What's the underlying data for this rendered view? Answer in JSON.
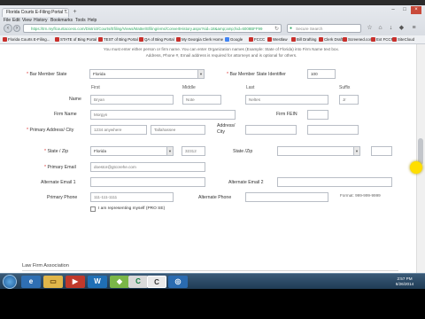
{
  "browser": {
    "tab1": "Florida Courts E-Filing Portal T...",
    "menu": [
      "File",
      "Edit",
      "View",
      "History",
      "Bookmarks",
      "Tools",
      "Help"
    ],
    "url": "https://trn.myflcourtaccess.com/District/Courts/Efiling/Views/Matter/Efiling/ems/ConvertHistory.aspx?sid=18&amp;amp;hid=6008BFF99",
    "search_placeholder": "Secure Search",
    "bookmarks": [
      "Florida Courts E-Filing...",
      "STATE of Bing Portal",
      "TEST of Bing Portal",
      "QA of Bing Portal",
      "My Georgia Clerk Home",
      "Google",
      "FCCC",
      "Westlaw",
      "Bill Drafting",
      "Clerk Drafts",
      "Screened.com",
      "Ext FCCF",
      "SiteCloud"
    ]
  },
  "form": {
    "notice": "You must enter either person or firm name. You can enter Organization names (Example: State of Florida) into Firm Name text box.",
    "notice2": "Address, Phone #, Email address is required for attorneys and is optional for others.",
    "bar_state_label": "Bar Member State",
    "bar_state_value": "Florida",
    "bar_id_label": "Bar Member State Identifier",
    "bar_id_value": "100",
    "col_first": "First",
    "col_middle": "Middle",
    "col_last": "Last",
    "col_suffix": "Suffix",
    "name_label": "Name",
    "first_value": "Bryan",
    "middle_value": "Note",
    "last_value": "Neltes",
    "suffix_value": "Jr",
    "firm_label": "Firm Name",
    "firm_value": "Morgyn",
    "fein_label": "Firm FEIN",
    "address_label": "Primary Address/ City",
    "address_value": "1234 anywhere",
    "city_value": "Tallahassee",
    "address2_label": "Address/ City",
    "state_zip_label": "State / Zip",
    "state_value": "Florida",
    "zip_value": "32312",
    "state_zip2_label": "State /Zip",
    "email_label": "Primary Email",
    "email_value": "doestor@gtcorehe.com",
    "alt1_label": "Alternate Email 1",
    "alt2_label": "Alternate Email 2",
    "phone_label": "Primary Phone",
    "phone_value": "111-111-1111",
    "alt_phone_label": "Alternate Phone",
    "phone_format": "Format: 999-999-9999",
    "pro_se_label": "I am representing myself (PRO SE)",
    "law_firm_section": "Law Firm Association"
  },
  "taskbar": {
    "time": "2:57 PM",
    "date": "6/26/2014"
  },
  "colors": {
    "accent": "#1e5b9a",
    "required": "#d33333"
  }
}
